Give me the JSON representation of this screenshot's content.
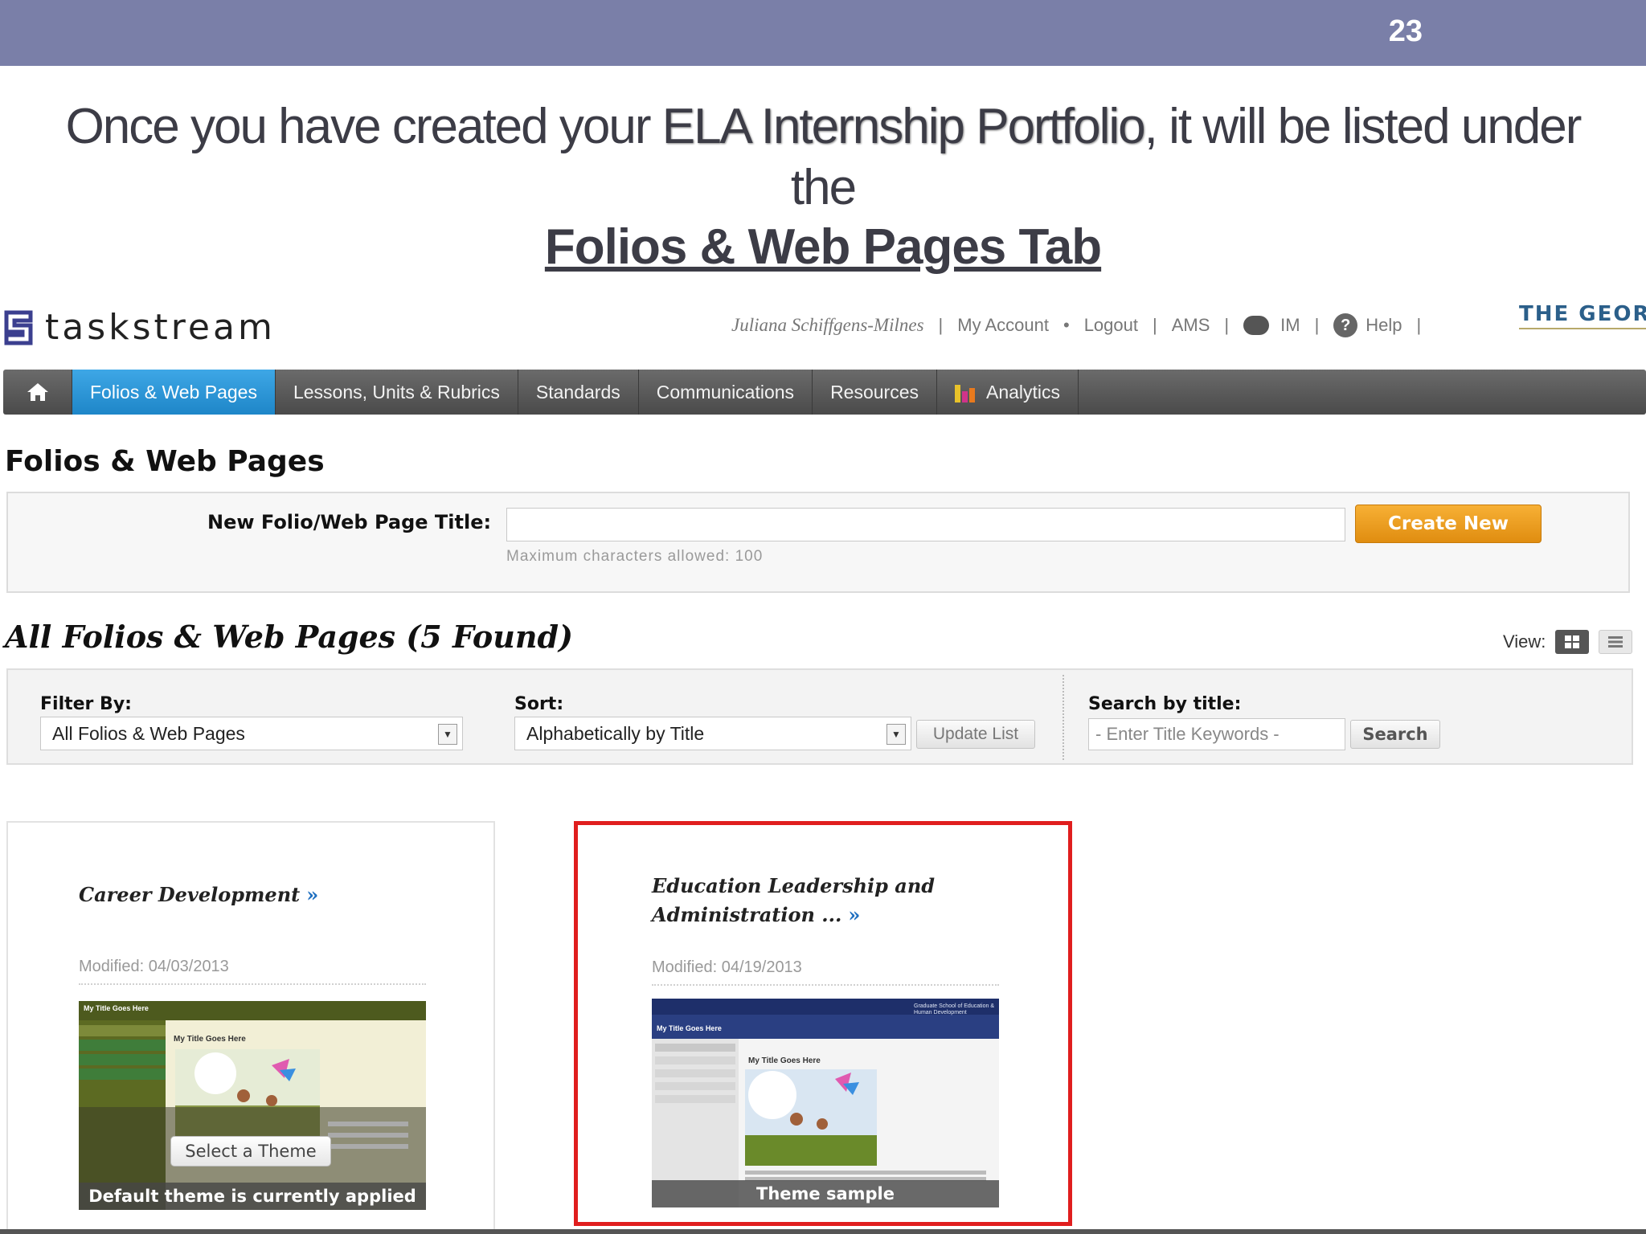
{
  "slide": {
    "number": "23",
    "heading_pre": "Once you have created your ",
    "heading_emph": "ELA Internship Portfolio",
    "heading_post": ", it  will be listed under",
    "heading_line2": "the",
    "heading_tab": "Folios & Web Pages Tab"
  },
  "app": {
    "logo_text": "taskstream",
    "user_name": "Juliana Schiffgens-Milnes",
    "links": {
      "my_account": "My Account",
      "logout": "Logout",
      "ams": "AMS",
      "im": "IM",
      "help": "Help"
    },
    "institution": "THE GEOR",
    "nav": [
      {
        "label": "Folios & Web Pages",
        "active": true
      },
      {
        "label": "Lessons, Units & Rubrics",
        "active": false
      },
      {
        "label": "Standards",
        "active": false
      },
      {
        "label": "Communications",
        "active": false
      },
      {
        "label": "Resources",
        "active": false
      },
      {
        "label": "Analytics",
        "active": false
      }
    ],
    "page_title": "Folios & Web Pages",
    "new_folio": {
      "label": "New Folio/Web Page Title:",
      "value": "",
      "hint": "Maximum characters allowed: 100",
      "button": "Create New"
    },
    "list_title": "All Folios & Web Pages (5 Found)",
    "view_label": "View:",
    "filter": {
      "filter_label": "Filter By:",
      "filter_value": "All Folios & Web Pages",
      "sort_label": "Sort:",
      "sort_value": "Alphabetically by Title",
      "update_button": "Update List",
      "search_label": "Search by title:",
      "search_placeholder": "- Enter Title Keywords -",
      "search_button": "Search"
    },
    "cards": [
      {
        "title": "Career Development",
        "modified": "Modified: 04/03/2013",
        "overlay_button": "Select a Theme",
        "caption": "Default theme is currently applied",
        "highlighted": false
      },
      {
        "title_line1": "Education Leadership and",
        "title_line2": "Administration ...",
        "modified": "Modified: 04/19/2013",
        "caption": "Theme sample",
        "highlighted": true,
        "highlight_color": "#e01e1e"
      }
    ],
    "thumb_text": {
      "my_title_here": "My Title Goes Here",
      "school": "Graduate School of Education & Human Development"
    }
  },
  "colors": {
    "band": "#7a7fa8",
    "nav_active": "#2a95d8",
    "create_btn": "#ed9c1e",
    "highlight": "#e01e1e"
  },
  "icons": [
    "home-icon",
    "chat-bubble-icon",
    "help-icon",
    "analytics-icon",
    "grid-view-icon",
    "list-view-icon",
    "dropdown-arrow-icon",
    "chevron-right-icon"
  ]
}
